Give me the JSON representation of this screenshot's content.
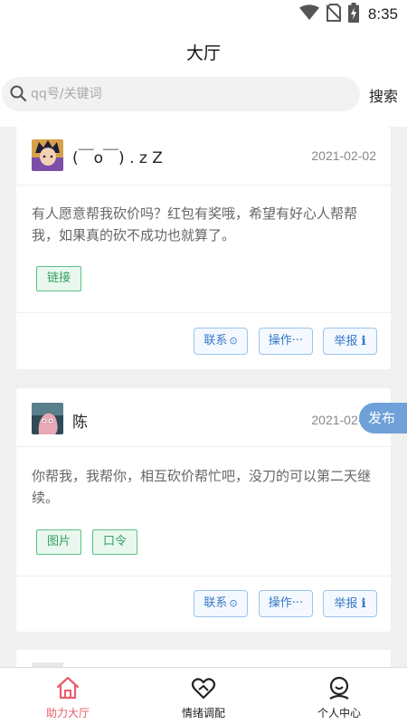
{
  "status_bar": {
    "time": "8:35",
    "icons": [
      "wifi-icon",
      "no-sim-icon",
      "battery-charging-icon"
    ]
  },
  "header": {
    "title": "大厅"
  },
  "search": {
    "placeholder": "qq号/关键词",
    "value": "",
    "button_label": "搜索"
  },
  "posts": [
    {
      "username": "(￣o￣) . z Z",
      "date": "2021-02-02",
      "content": "有人愿意帮我砍价吗？红包有奖哦，希望有好心人帮帮我，如果真的砍不成功也就算了。",
      "tags": [
        "链接"
      ],
      "actions": {
        "contact": "联系",
        "operate": "操作",
        "report": "举报"
      }
    },
    {
      "username": "陈",
      "date": "2021-02-02",
      "content": "你帮我，我帮你，相互砍价帮忙吧，没刀的可以第二天继续。",
      "tags": [
        "图片",
        "口令"
      ],
      "actions": {
        "contact": "联系",
        "operate": "操作",
        "report": "举报"
      }
    }
  ],
  "fab": {
    "label": "发布"
  },
  "tabbar": {
    "items": [
      {
        "label": "助力大厅",
        "icon": "home-icon",
        "active": true
      },
      {
        "label": "情绪调配",
        "icon": "heart-hands-icon",
        "active": false
      },
      {
        "label": "个人中心",
        "icon": "person-icon",
        "active": false
      }
    ]
  },
  "colors": {
    "accent": "#e85d6a",
    "tag_green": "#34a060",
    "action_blue": "#3478c6",
    "fab_blue": "#6fa0d8"
  }
}
